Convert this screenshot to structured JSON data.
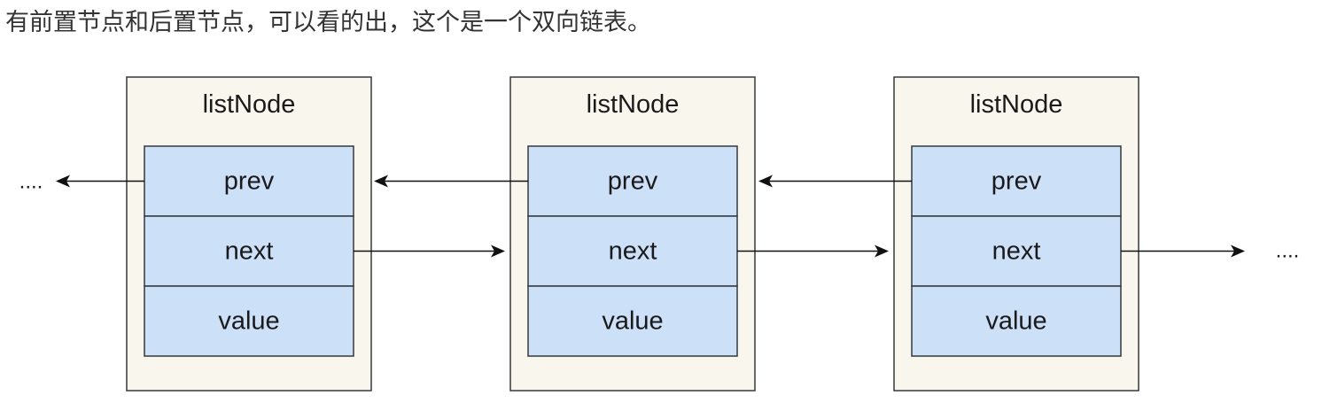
{
  "caption": "有前置节点和后置节点，可以看的出，这个是一个双向链表。",
  "nodes": [
    {
      "title": "listNode",
      "fields": [
        {
          "key": "prev",
          "label": "prev"
        },
        {
          "key": "next",
          "label": "next"
        },
        {
          "key": "value",
          "label": "value"
        }
      ]
    },
    {
      "title": "listNode",
      "fields": [
        {
          "key": "prev",
          "label": "prev"
        },
        {
          "key": "next",
          "label": "next"
        },
        {
          "key": "value",
          "label": "value"
        }
      ]
    },
    {
      "title": "listNode",
      "fields": [
        {
          "key": "prev",
          "label": "prev"
        },
        {
          "key": "next",
          "label": "next"
        },
        {
          "key": "value",
          "label": "value"
        }
      ]
    }
  ],
  "ellipsis_left": "....",
  "ellipsis_right": "....",
  "colors": {
    "node_fill": "#f9f7ed",
    "field_fill": "#cce0f7",
    "stroke": "#36393d",
    "arrow": "#111111"
  }
}
